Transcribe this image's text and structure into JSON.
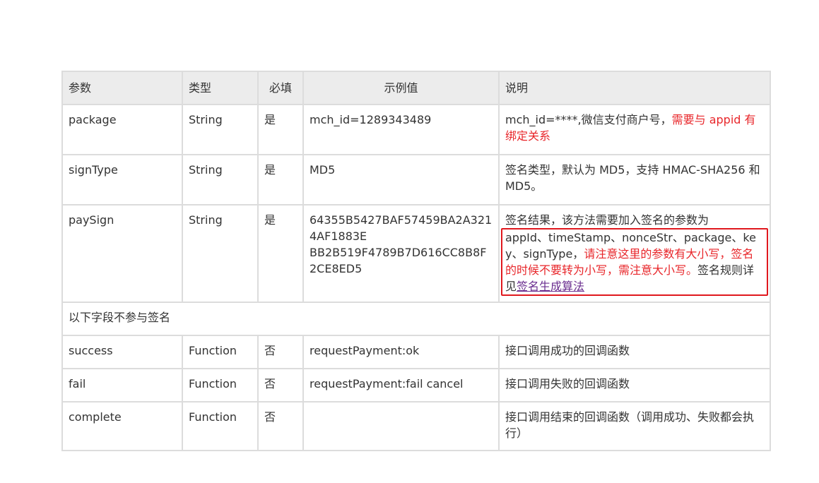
{
  "headers": {
    "param": "参数",
    "type": "类型",
    "required": "必填",
    "example": "示例值",
    "desc": "说明"
  },
  "rows": {
    "package": {
      "param": "package",
      "type": "String",
      "required": "是",
      "example": "mch_id=1289343489",
      "desc_prefix": "mch_id=****,微信支付商户号，",
      "desc_red": "需要与 appid 有绑定关系"
    },
    "signType": {
      "param": "signType",
      "type": "String",
      "required": "是",
      "example": "MD5",
      "desc": "签名类型，默认为 MD5，支持 HMAC-SHA256 和 MD5。"
    },
    "paySign": {
      "param": "paySign",
      "type": "String",
      "required": "是",
      "example_line1": "64355B5427BAF57459BA2A3214AF1883E",
      "example_line2": "BB2B519F4789B7D616CC8B8F2CE8ED5",
      "desc_first": "签名结果，该方法需要加入签名的参数为",
      "desc_params": "appId、timeStamp、nonceStr、package、key、signType，",
      "desc_red": "请注意这里的参数有大小写，签名的时候不要转为小写，需注意大小写。",
      "desc_rule": "签名规则详见",
      "desc_link": "签名生成算法"
    },
    "section": {
      "label": "以下字段不参与签名"
    },
    "success": {
      "param": "success",
      "type": "Function",
      "required": "否",
      "example": "requestPayment:ok",
      "desc": "接口调用成功的回调函数"
    },
    "fail": {
      "param": "fail",
      "type": "Function",
      "required": "否",
      "example": "requestPayment:fail cancel",
      "desc": "接口调用失败的回调函数"
    },
    "complete": {
      "param": "complete",
      "type": "Function",
      "required": "否",
      "example": "",
      "desc": "接口调用结束的回调函数（调用成功、失败都会执行）"
    }
  },
  "colors": {
    "header_bg": "#ececec",
    "border": "#dcdcdc",
    "red_text": "#e8262a",
    "highlight_box": "#e0181e",
    "link": "#6a2d8f"
  }
}
